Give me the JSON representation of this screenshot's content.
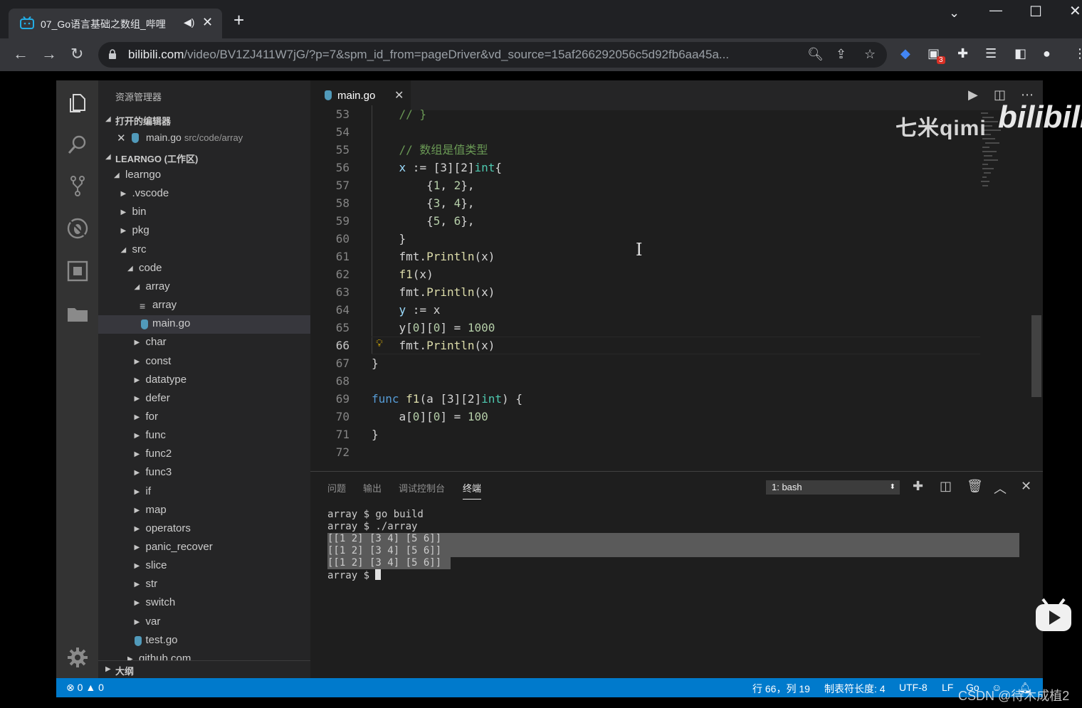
{
  "browser": {
    "tab_title": "07_Go语言基础之数组_哔哩",
    "url_host": "bilibili.com",
    "url_path": "/video/BV1ZJ411W7jG/?p=7&spm_id_from=pageDriver&vd_source=15af266292056c5d92fb6aa45a...",
    "extension_badge": "3"
  },
  "vscode": {
    "sidebar": {
      "title": "资源管理器",
      "open_editors_label": "打开的编辑器",
      "open_editor_file": "main.go",
      "open_editor_path": "src/code/array",
      "workspace_label": "LEARNGO (工作区)",
      "tree": [
        {
          "label": "learngo",
          "depth": 0,
          "kind": "folder-open"
        },
        {
          "label": ".vscode",
          "depth": 1,
          "kind": "folder"
        },
        {
          "label": "bin",
          "depth": 1,
          "kind": "folder"
        },
        {
          "label": "pkg",
          "depth": 1,
          "kind": "folder"
        },
        {
          "label": "src",
          "depth": 1,
          "kind": "folder-open"
        },
        {
          "label": "code",
          "depth": 2,
          "kind": "folder-open"
        },
        {
          "label": "array",
          "depth": 3,
          "kind": "folder-open"
        },
        {
          "label": "array",
          "depth": 4,
          "kind": "binary"
        },
        {
          "label": "main.go",
          "depth": 4,
          "kind": "go",
          "selected": true
        },
        {
          "label": "char",
          "depth": 3,
          "kind": "folder"
        },
        {
          "label": "const",
          "depth": 3,
          "kind": "folder"
        },
        {
          "label": "datatype",
          "depth": 3,
          "kind": "folder"
        },
        {
          "label": "defer",
          "depth": 3,
          "kind": "folder"
        },
        {
          "label": "for",
          "depth": 3,
          "kind": "folder"
        },
        {
          "label": "func",
          "depth": 3,
          "kind": "folder"
        },
        {
          "label": "func2",
          "depth": 3,
          "kind": "folder"
        },
        {
          "label": "func3",
          "depth": 3,
          "kind": "folder"
        },
        {
          "label": "if",
          "depth": 3,
          "kind": "folder"
        },
        {
          "label": "map",
          "depth": 3,
          "kind": "folder"
        },
        {
          "label": "operators",
          "depth": 3,
          "kind": "folder"
        },
        {
          "label": "panic_recover",
          "depth": 3,
          "kind": "folder"
        },
        {
          "label": "slice",
          "depth": 3,
          "kind": "folder"
        },
        {
          "label": "str",
          "depth": 3,
          "kind": "folder"
        },
        {
          "label": "switch",
          "depth": 3,
          "kind": "folder"
        },
        {
          "label": "var",
          "depth": 3,
          "kind": "folder"
        },
        {
          "label": "test.go",
          "depth": 3,
          "kind": "go"
        },
        {
          "label": "github.com",
          "depth": 2,
          "kind": "folder"
        }
      ],
      "outline_label": "大纲"
    },
    "editor": {
      "tab_label": "main.go",
      "active_line": "66",
      "lines": [
        {
          "n": "53",
          "tokens": [
            {
              "t": "    ",
              "c": ""
            },
            {
              "t": "// }",
              "c": "cm"
            }
          ]
        },
        {
          "n": "54",
          "tokens": []
        },
        {
          "n": "55",
          "tokens": [
            {
              "t": "    ",
              "c": ""
            },
            {
              "t": "// 数组是值类型",
              "c": "cm"
            }
          ]
        },
        {
          "n": "56",
          "tokens": [
            {
              "t": "    ",
              "c": ""
            },
            {
              "t": "x",
              "c": "var"
            },
            {
              "t": " := [3][2]",
              "c": ""
            },
            {
              "t": "int",
              "c": "ty"
            },
            {
              "t": "{",
              "c": ""
            }
          ]
        },
        {
          "n": "57",
          "tokens": [
            {
              "t": "        {",
              "c": ""
            },
            {
              "t": "1",
              "c": "nm"
            },
            {
              "t": ", ",
              "c": ""
            },
            {
              "t": "2",
              "c": "nm"
            },
            {
              "t": "},",
              "c": ""
            }
          ]
        },
        {
          "n": "58",
          "tokens": [
            {
              "t": "        {",
              "c": ""
            },
            {
              "t": "3",
              "c": "nm"
            },
            {
              "t": ", ",
              "c": ""
            },
            {
              "t": "4",
              "c": "nm"
            },
            {
              "t": "},",
              "c": ""
            }
          ]
        },
        {
          "n": "59",
          "tokens": [
            {
              "t": "        {",
              "c": ""
            },
            {
              "t": "5",
              "c": "nm"
            },
            {
              "t": ", ",
              "c": ""
            },
            {
              "t": "6",
              "c": "nm"
            },
            {
              "t": "},",
              "c": ""
            }
          ]
        },
        {
          "n": "60",
          "tokens": [
            {
              "t": "    }",
              "c": ""
            }
          ]
        },
        {
          "n": "61",
          "tokens": [
            {
              "t": "    fmt.",
              "c": ""
            },
            {
              "t": "Println",
              "c": "fn"
            },
            {
              "t": "(x)",
              "c": ""
            }
          ]
        },
        {
          "n": "62",
          "tokens": [
            {
              "t": "    ",
              "c": ""
            },
            {
              "t": "f1",
              "c": "fn"
            },
            {
              "t": "(x)",
              "c": ""
            }
          ]
        },
        {
          "n": "63",
          "tokens": [
            {
              "t": "    fmt.",
              "c": ""
            },
            {
              "t": "Println",
              "c": "fn"
            },
            {
              "t": "(x)",
              "c": ""
            }
          ]
        },
        {
          "n": "64",
          "tokens": [
            {
              "t": "    ",
              "c": ""
            },
            {
              "t": "y",
              "c": "var"
            },
            {
              "t": " := x",
              "c": ""
            }
          ]
        },
        {
          "n": "65",
          "tokens": [
            {
              "t": "    y[",
              "c": ""
            },
            {
              "t": "0",
              "c": "nm"
            },
            {
              "t": "][",
              "c": ""
            },
            {
              "t": "0",
              "c": "nm"
            },
            {
              "t": "] = ",
              "c": ""
            },
            {
              "t": "1000",
              "c": "nm"
            }
          ]
        },
        {
          "n": "66",
          "tokens": [
            {
              "t": "    fmt.",
              "c": ""
            },
            {
              "t": "Println",
              "c": "fn"
            },
            {
              "t": "(x)",
              "c": ""
            }
          ]
        },
        {
          "n": "67",
          "tokens": [
            {
              "t": "}",
              "c": ""
            }
          ]
        },
        {
          "n": "68",
          "tokens": []
        },
        {
          "n": "69",
          "tokens": [
            {
              "t": "func",
              "c": "kw"
            },
            {
              "t": " ",
              "c": ""
            },
            {
              "t": "f1",
              "c": "fn"
            },
            {
              "t": "(a [3][2]",
              "c": ""
            },
            {
              "t": "int",
              "c": "ty"
            },
            {
              "t": ") {",
              "c": ""
            }
          ]
        },
        {
          "n": "70",
          "tokens": [
            {
              "t": "    a[",
              "c": ""
            },
            {
              "t": "0",
              "c": "nm"
            },
            {
              "t": "][",
              "c": ""
            },
            {
              "t": "0",
              "c": "nm"
            },
            {
              "t": "] = ",
              "c": ""
            },
            {
              "t": "100",
              "c": "nm"
            }
          ]
        },
        {
          "n": "71",
          "tokens": [
            {
              "t": "}",
              "c": ""
            }
          ]
        },
        {
          "n": "72",
          "tokens": []
        }
      ]
    },
    "panel": {
      "tabs": [
        "问题",
        "输出",
        "调试控制台",
        "终端"
      ],
      "active_tab": "终端",
      "terminal_select": "1: bash",
      "terminal_lines": [
        "array $ go build",
        "array $ ./array",
        "[[1 2] [3 4] [5 6]]",
        "[[1 2] [3 4] [5 6]]",
        "[[1 2] [3 4] [5 6]]",
        "array $ "
      ]
    },
    "statusbar": {
      "errors": "0",
      "warnings": "0",
      "position": "行 66，列 19",
      "tab_size": "制表符长度: 4",
      "encoding": "UTF-8",
      "eol": "LF",
      "language": "Go"
    }
  },
  "watermarks": {
    "uploader": "七米qimi",
    "site": "bilibili",
    "csdn": "CSDN @待木成植2"
  },
  "colors": {
    "status_bar": "#007acc",
    "activity_bar": "#333333",
    "sidebar": "#252526",
    "editor": "#1e1e1e"
  }
}
